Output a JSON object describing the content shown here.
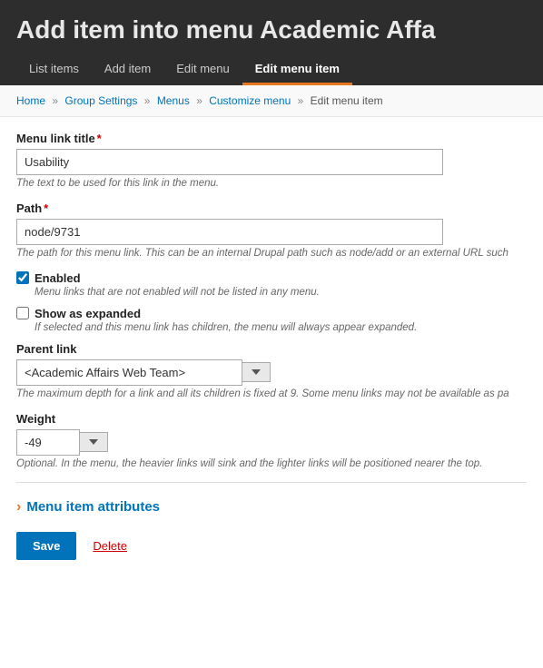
{
  "header": {
    "title": "Add item into menu Academic Affa",
    "tabs": [
      {
        "id": "list-items",
        "label": "List items",
        "active": false
      },
      {
        "id": "add-item",
        "label": "Add item",
        "active": false
      },
      {
        "id": "edit-menu",
        "label": "Edit menu",
        "active": false
      },
      {
        "id": "edit-menu-item",
        "label": "Edit menu item",
        "active": true
      }
    ]
  },
  "breadcrumb": {
    "items": [
      {
        "label": "Home",
        "href": "#"
      },
      {
        "label": "Group Settings",
        "href": "#"
      },
      {
        "label": "Menus",
        "href": "#"
      },
      {
        "label": "Customize menu",
        "href": "#"
      },
      {
        "label": "Edit menu item",
        "href": null
      }
    ]
  },
  "form": {
    "menu_link_title_label": "Menu link title",
    "menu_link_title_value": "Usability",
    "menu_link_title_hint": "The text to be used for this link in the menu.",
    "path_label": "Path",
    "path_value": "node/9731",
    "path_hint_prefix": "The path for this menu link. This can be an internal Drupal path such as ",
    "path_hint_code": "node/add",
    "path_hint_suffix": " or an external URL such",
    "enabled_label": "Enabled",
    "enabled_checked": true,
    "enabled_hint": "Menu links that are not enabled will not be listed in any menu.",
    "show_expanded_label": "Show as expanded",
    "show_expanded_checked": false,
    "show_expanded_hint": "If selected and this menu link has children, the menu will always appear expanded.",
    "parent_link_label": "Parent link",
    "parent_link_value": "<Academic Affairs Web Team>",
    "parent_link_depth_hint": "The maximum depth for a link and all its children is fixed at 9. Some menu links may not be available as pa",
    "weight_label": "Weight",
    "weight_value": "-49",
    "weight_hint": "Optional. In the menu, the heavier links will sink and the lighter links will be positioned nearer the top.",
    "menu_item_attributes_label": "Menu item attributes",
    "save_label": "Save",
    "delete_label": "Delete"
  },
  "icons": {
    "chevron_right": "›",
    "chevron_down": "▾"
  }
}
